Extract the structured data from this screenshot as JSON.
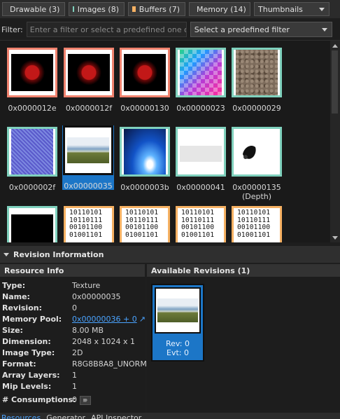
{
  "toolbar": {
    "tabs": [
      {
        "label": "Drawable (3)",
        "color": "#f2685c"
      },
      {
        "label": "Images (8)",
        "color": "#7fd1bd"
      },
      {
        "label": "Buffers (7)",
        "color": "#f6b163"
      },
      {
        "label": "Memory (14)",
        "color": "#7aa2e6"
      }
    ],
    "view_mode": "Thumbnails"
  },
  "filter": {
    "label": "Filter:",
    "placeholder": "Enter a filter or select a predefined one on the",
    "predefined": "Select a predefined filter"
  },
  "grid": {
    "items": [
      {
        "label": "0x0000012e",
        "kind": "drawable",
        "texture": "fruit"
      },
      {
        "label": "0x0000012f",
        "kind": "drawable",
        "texture": "fruit"
      },
      {
        "label": "0x00000130",
        "kind": "drawable",
        "texture": "fruit"
      },
      {
        "label": "0x00000023",
        "kind": "image",
        "texture": "gradient"
      },
      {
        "label": "0x00000029",
        "kind": "image",
        "texture": "rock"
      },
      {
        "label": "0x0000002f",
        "kind": "image",
        "texture": "noise"
      },
      {
        "label": "0x00000035",
        "kind": "image",
        "texture": "sky",
        "selected": true
      },
      {
        "label": "0x0000003b",
        "kind": "image",
        "texture": "blue"
      },
      {
        "label": "0x00000041",
        "kind": "image",
        "texture": "blank"
      },
      {
        "label": "0x00000135",
        "sublabel": "(Depth)",
        "kind": "image",
        "texture": "depth"
      },
      {
        "label": "",
        "kind": "image",
        "texture": "black"
      },
      {
        "label": "",
        "kind": "buffer",
        "texture": "binary"
      },
      {
        "label": "",
        "kind": "buffer",
        "texture": "binary"
      },
      {
        "label": "",
        "kind": "buffer",
        "texture": "binary"
      },
      {
        "label": "",
        "kind": "buffer",
        "texture": "binary"
      }
    ],
    "binary_text": "10110101\n10110111\n00101100\n01001101"
  },
  "revision": {
    "header": "Revision Information",
    "resource_info_title": "Resource Info",
    "available_title": "Available Revisions (1)",
    "fields": [
      {
        "key": "Type:",
        "value": "Texture"
      },
      {
        "key": "Name:",
        "value": "0x00000035"
      },
      {
        "key": "Revision:",
        "value": "0"
      },
      {
        "key": "Memory Pool:",
        "value": "0x00000036 + 0",
        "link": true
      },
      {
        "key": "Size:",
        "value": "8.00 MB"
      },
      {
        "key": "Dimension:",
        "value": "2048 x 1024 x 1"
      },
      {
        "key": "Image Type:",
        "value": "2D"
      },
      {
        "key": "Format:",
        "value": "R8G8B8A8_UNORM"
      },
      {
        "key": "Array Layers:",
        "value": "1"
      },
      {
        "key": "Mip Levels:",
        "value": "1"
      },
      {
        "key": "# Consumptions:",
        "value": "0",
        "button": true
      }
    ],
    "card": {
      "rev": "Rev: 0",
      "evt": "Evt: 0"
    }
  },
  "bottom_tabs": [
    "Resources",
    "Generator",
    "API Inspector"
  ]
}
